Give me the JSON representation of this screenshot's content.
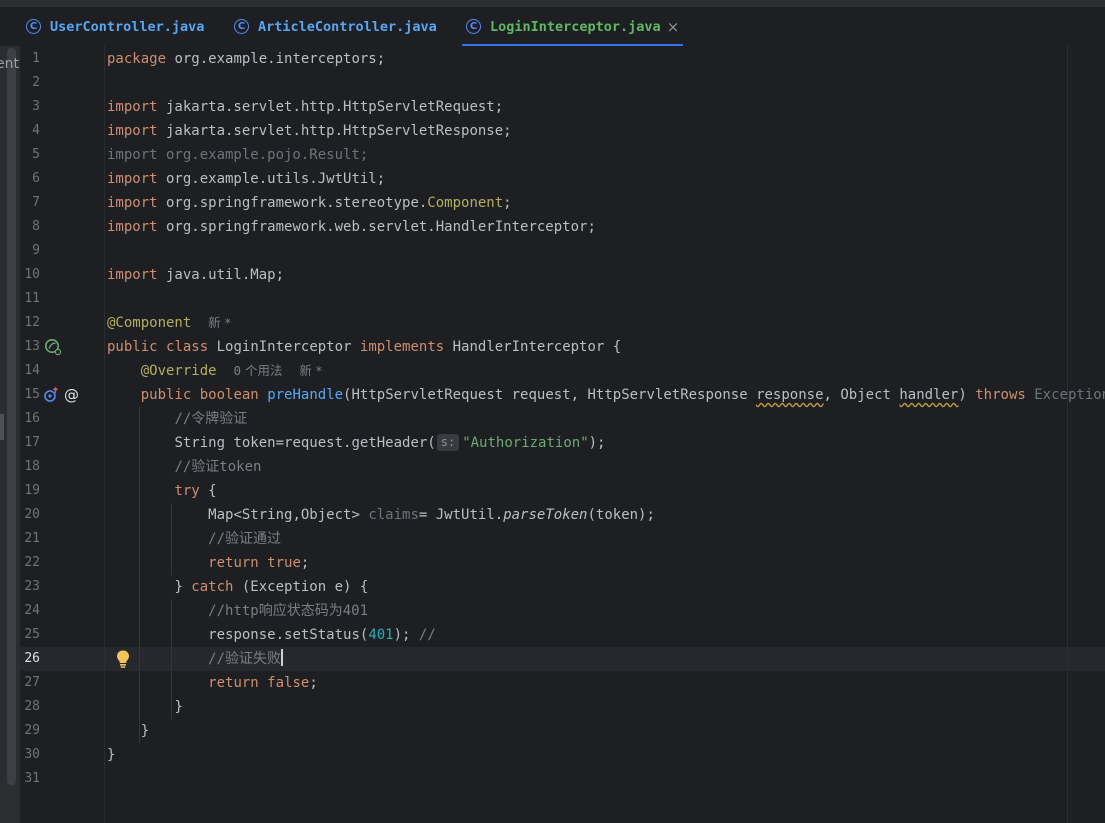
{
  "tabs": [
    {
      "label": "UserController.java",
      "icon": "class-icon",
      "active": false
    },
    {
      "label": "ArticleController.java",
      "icon": "class-icon",
      "active": false
    },
    {
      "label": "LoginInterceptor.java",
      "icon": "class-icon",
      "active": true,
      "close": "×"
    }
  ],
  "side_label": "ent",
  "class_icon_glyph": "C",
  "editor": {
    "line_numbers": [
      "1",
      "2",
      "3",
      "4",
      "5",
      "6",
      "7",
      "8",
      "9",
      "10",
      "11",
      "12",
      "13",
      "14",
      "15",
      "16",
      "17",
      "18",
      "19",
      "20",
      "21",
      "22",
      "23",
      "24",
      "25",
      "26",
      "27",
      "28",
      "29",
      "30",
      "31"
    ],
    "current_line": 26,
    "lines": {
      "l1": [
        "package",
        " org.example.interceptors;"
      ],
      "l3": [
        "import",
        " jakarta.servlet.http.HttpServletRequest;"
      ],
      "l4": [
        "import",
        " jakarta.servlet.http.HttpServletResponse;"
      ],
      "l5": [
        "import org.example.pojo.Result;"
      ],
      "l6": [
        "import",
        " org.example.utils.JwtUtil;"
      ],
      "l7": [
        "import",
        " org.springframework.stereotype.",
        "Component",
        ";"
      ],
      "l8": [
        "import",
        " org.springframework.web.servlet.HandlerInterceptor;"
      ],
      "l10": [
        "import",
        " java.util.Map;"
      ],
      "l12": [
        "@Component"
      ],
      "l12_hint": "新 *",
      "l13": [
        "public",
        " ",
        "class",
        " LoginInterceptor ",
        "implements",
        " HandlerInterceptor {"
      ],
      "l14": [
        "@Override"
      ],
      "l14_hint_count": "0",
      "l14_hint_usages": " 个用法",
      "l14_hint_new": "新 *",
      "l15": [
        "public",
        " ",
        "boolean",
        " ",
        "preHandle",
        "(HttpServletRequest request, HttpServletResponse ",
        "response",
        ", Object ",
        "handler",
        ") ",
        "throws",
        " ",
        "Exception",
        " {"
      ],
      "l16": [
        "//令牌验证"
      ],
      "l17": [
        "String token=request.getHeader(",
        "s:",
        "\"Authorization\"",
        ");"
      ],
      "l18": [
        "//验证token"
      ],
      "l19": [
        "try",
        " {"
      ],
      "l20": [
        "Map<String,Object> ",
        "claims",
        "= JwtUtil.",
        "parseToken",
        "(token);"
      ],
      "l21": [
        "//验证通过"
      ],
      "l22": [
        "return",
        " ",
        "true",
        ";"
      ],
      "l23": [
        "} ",
        "catch",
        " (Exception e) {"
      ],
      "l24": [
        "//http响应状态码为401"
      ],
      "l25": [
        "response.setStatus(",
        "401",
        "); ",
        "//"
      ],
      "l26": [
        "//验证失败"
      ],
      "l27": [
        "return",
        " ",
        "false",
        ";"
      ],
      "l28": [
        "}"
      ],
      "l29": [
        "}"
      ],
      "l30": [
        "}"
      ]
    }
  },
  "gutter_icons": {
    "line13": "spring-bean-icon",
    "line15": [
      "override-method-icon",
      "at-icon"
    ],
    "line26": "lightbulb-icon",
    "at_glyph": "@"
  },
  "colors": {
    "background": "#1e1f22",
    "keyword": "#cf8e6d",
    "annotation": "#b3ae60",
    "function": "#56a8f5",
    "string": "#6aab73",
    "number": "#2aacb8",
    "comment": "#7a7e85",
    "tab_active_underline": "#3574f0"
  }
}
